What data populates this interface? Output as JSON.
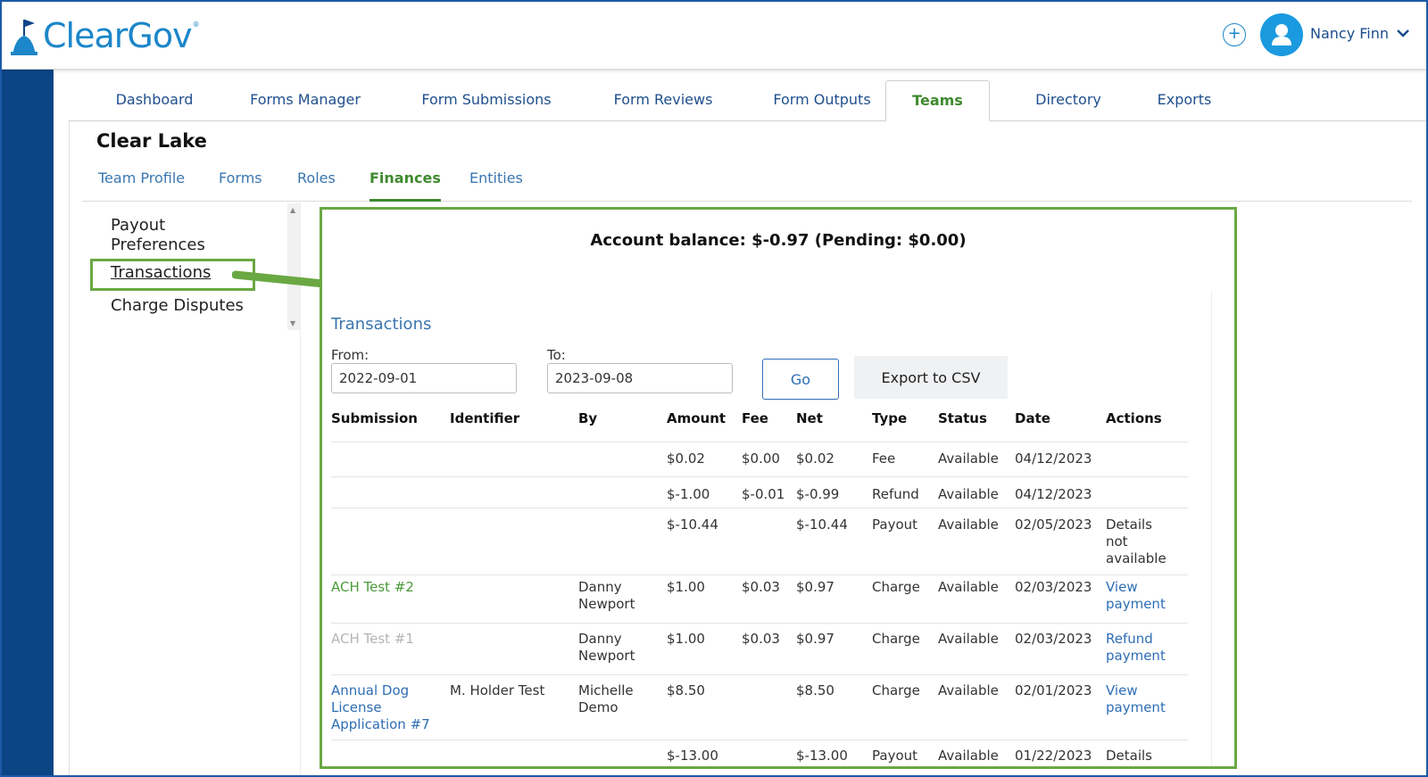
{
  "header": {
    "logo_text": "ClearGov",
    "user_name": "Nancy Finn",
    "icons": {
      "add": "plus-circle-icon",
      "avatar": "user-avatar-icon",
      "chevron": "chevron-down-icon"
    }
  },
  "main_tabs": [
    "Dashboard",
    "Forms Manager",
    "Form Submissions",
    "Form Reviews",
    "Form Outputs",
    "Teams",
    "Directory",
    "Exports"
  ],
  "main_tab_active": "Teams",
  "team": {
    "title": "Clear Lake"
  },
  "sub_tabs": [
    "Team Profile",
    "Forms",
    "Roles",
    "Finances",
    "Entities"
  ],
  "sub_tab_active": "Finances",
  "side_menu": [
    "Payout Preferences",
    "Transactions",
    "Charge Disputes"
  ],
  "balance": {
    "text": "Account balance: $-0.97 (Pending: $0.00)"
  },
  "transactions": {
    "title": "Transactions",
    "from_label": "From:",
    "from_value": "2022-09-01",
    "to_label": "To:",
    "to_value": "2023-09-08",
    "go_label": "Go",
    "export_label": "Export to CSV",
    "columns": [
      "Submission",
      "Identifier",
      "By",
      "Amount",
      "Fee",
      "Net",
      "Type",
      "Status",
      "Date",
      "Actions"
    ],
    "rows": [
      {
        "submission": "",
        "identifier": "",
        "by": "",
        "amount": "$0.02",
        "fee": "$0.00",
        "net": "$0.02",
        "type": "Fee",
        "status": "Available",
        "date": "04/12/2023",
        "action": ""
      },
      {
        "submission": "",
        "identifier": "",
        "by": "",
        "amount": "$-1.00",
        "fee": "$-0.01",
        "net": "$-0.99",
        "type": "Refund",
        "status": "Available",
        "date": "04/12/2023",
        "action": ""
      },
      {
        "submission": "",
        "identifier": "",
        "by": "",
        "amount": "$-10.44",
        "fee": "",
        "net": "$-10.44",
        "type": "Payout",
        "status": "Available",
        "date": "02/05/2023",
        "action": "Details not available"
      },
      {
        "submission": "ACH Test #2",
        "identifier": "",
        "by": "Danny Newport",
        "amount": "$1.00",
        "fee": "$0.03",
        "net": "$0.97",
        "type": "Charge",
        "status": "Available",
        "date": "02/03/2023",
        "action": "View payment"
      },
      {
        "submission": "ACH Test #1",
        "identifier": "",
        "by": "Danny Newport",
        "amount": "$1.00",
        "fee": "$0.03",
        "net": "$0.97",
        "type": "Charge",
        "status": "Available",
        "date": "02/03/2023",
        "action": "Refund payment"
      },
      {
        "submission": "Annual Dog License Application #7",
        "identifier": "M. Holder Test",
        "by": "Michelle Demo",
        "amount": "$8.50",
        "fee": "",
        "net": "$8.50",
        "type": "Charge",
        "status": "Available",
        "date": "02/01/2023",
        "action": "View payment"
      },
      {
        "submission": "",
        "identifier": "",
        "by": "",
        "amount": "$-13.00",
        "fee": "",
        "net": "$-13.00",
        "type": "Payout",
        "status": "Available",
        "date": "01/22/2023",
        "action": "Details not available"
      }
    ]
  },
  "colors": {
    "brand_blue": "#1b86c9",
    "rail": "#0c4586",
    "active_green": "#3f8a2f",
    "highlight": "#6aa843"
  }
}
